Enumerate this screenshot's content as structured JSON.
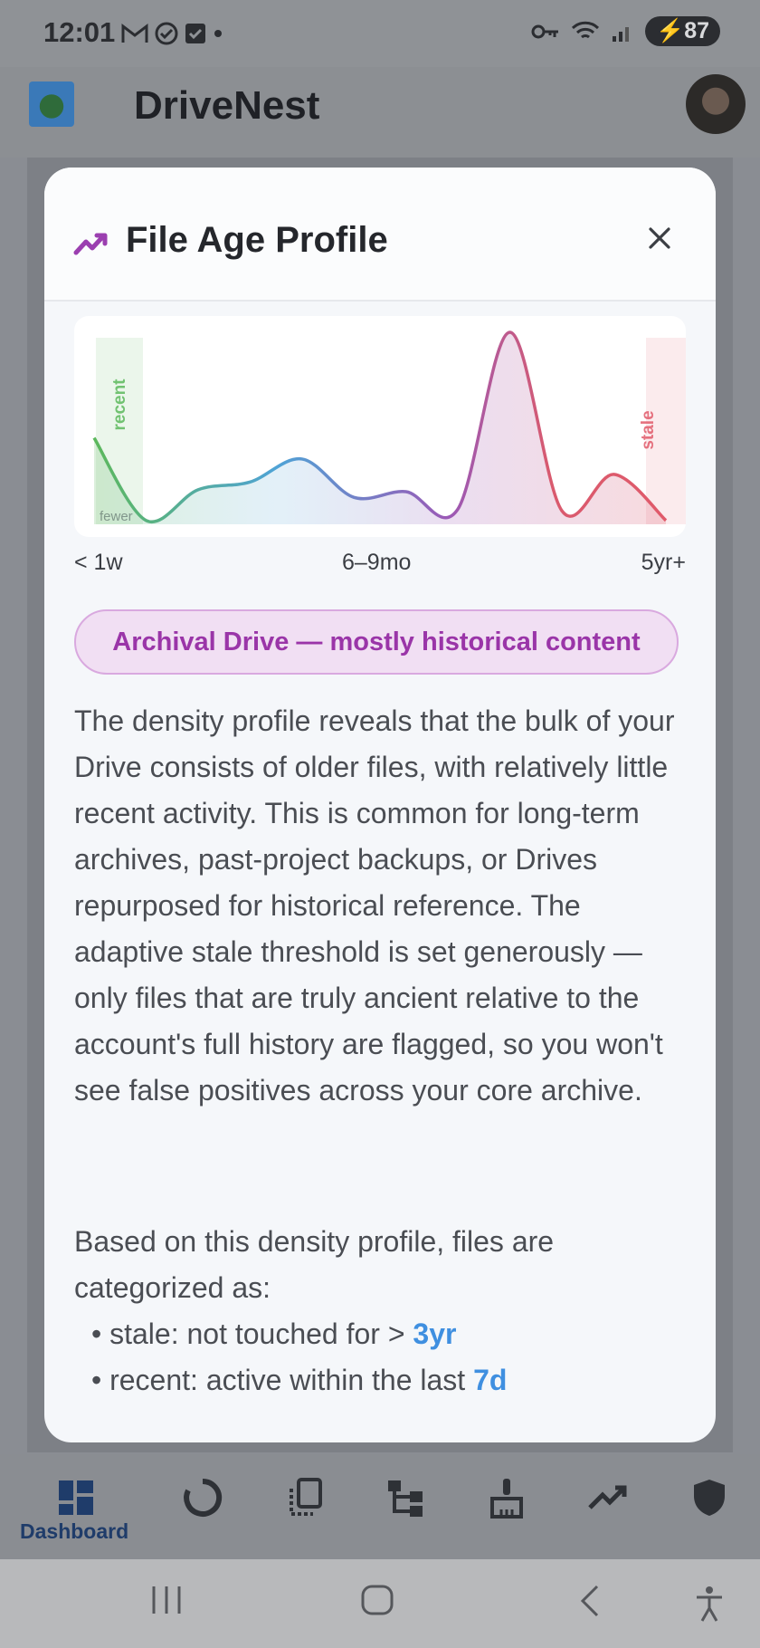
{
  "status_bar": {
    "time": "12:01",
    "battery": "87"
  },
  "app_bar": {
    "title": "DriveNest"
  },
  "bottom_nav": {
    "items": [
      {
        "label": "Dashboard"
      }
    ]
  },
  "modal": {
    "title": "File Age Profile",
    "chart": {
      "zone_left_label": "recent",
      "zone_right_label": "stale",
      "floor_label": "fewer",
      "x_labels": [
        "< 1w",
        "6–9mo",
        "5yr+"
      ]
    },
    "badge": "Archival Drive — mostly historical content",
    "description": "The density profile reveals that the bulk of your Drive consists of older files, with relatively little recent activity. This is common for long-term archives, past-project backups, or Drives repurposed for historical reference. The adaptive stale threshold is set generously — only files that are truly ancient relative to the account's full history are flagged, so you won't see false positives across your core archive.",
    "based_on": "Based on this density profile, files are categorized as:",
    "stale_prefix": "stale: not touched for > ",
    "stale_value": "3yr",
    "recent_prefix": "recent: active within the last ",
    "recent_value": "7d"
  },
  "chart_data": {
    "type": "area",
    "x_tick_labels": [
      "< 1w",
      "6–9mo",
      "5yr+"
    ],
    "y": [
      0.45,
      0.02,
      0.18,
      0.22,
      0.34,
      0.14,
      0.17,
      0.08,
      1.0,
      0.07,
      0.26,
      0.02
    ],
    "zones": [
      {
        "name": "recent",
        "color": "#5cb85c"
      },
      {
        "name": "stale",
        "color": "#e05a6a"
      }
    ],
    "colors": [
      "#5cb85c",
      "#4fa3d6",
      "#9b59b6",
      "#e05a6a"
    ],
    "grid": false
  }
}
